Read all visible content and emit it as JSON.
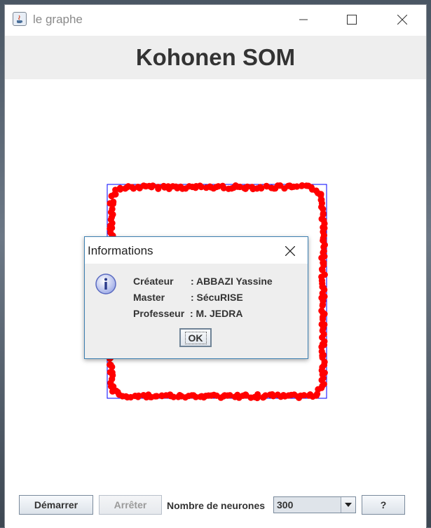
{
  "window": {
    "title": "le graphe",
    "icon": "java-icon"
  },
  "header": {
    "title": "Kohonen SOM"
  },
  "plot": {
    "point_color": "#ff0000",
    "frame_color": "#0000ff"
  },
  "controls": {
    "start_label": "Démarrer",
    "stop_label": "Arrêter",
    "neurons_label": "Nombre de neurones",
    "neurons_value": "300",
    "help_label": "?"
  },
  "dialog": {
    "title": "Informations",
    "rows": [
      {
        "key": "Créateur",
        "value": ": ABBAZI Yassine"
      },
      {
        "key": "Master",
        "value": ": SécuRISE"
      },
      {
        "key": "Professeur",
        "value": ": M. JEDRA"
      }
    ],
    "ok_label": "OK"
  }
}
